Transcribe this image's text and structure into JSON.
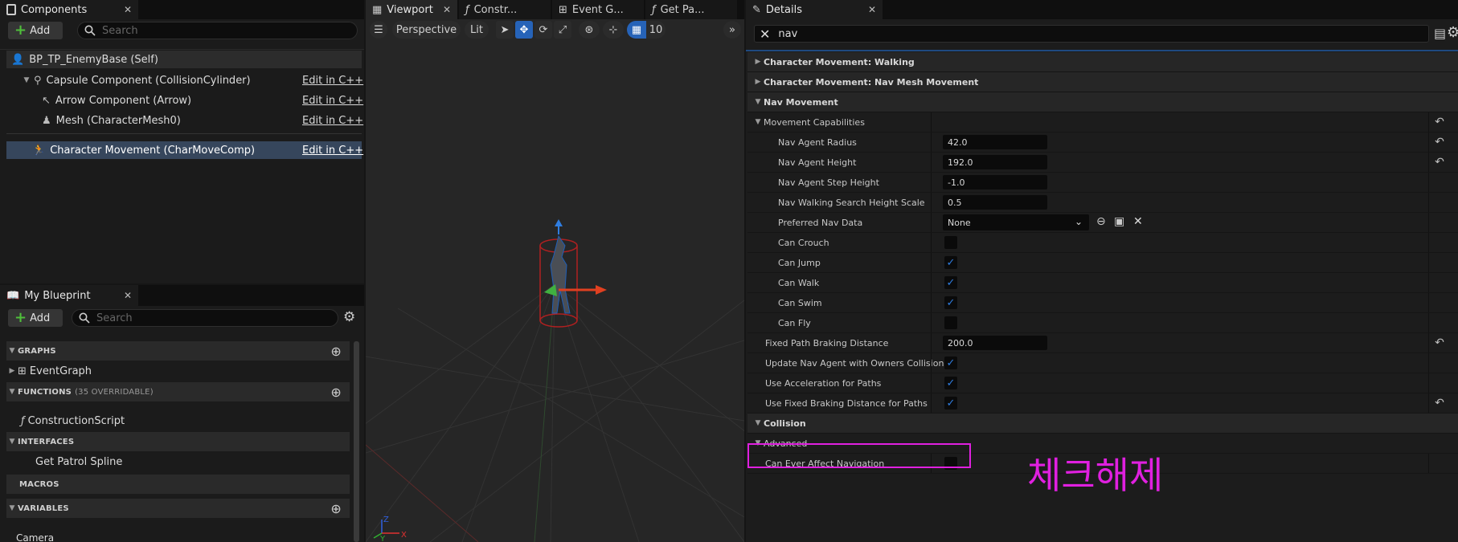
{
  "components": {
    "tab_title": "Components",
    "add_label": "Add",
    "search_placeholder": "Search",
    "root": "BP_TP_EnemyBase (Self)",
    "capsule": "Capsule Component (CollisionCylinder)",
    "arrow": "Arrow Component (Arrow)",
    "mesh": "Mesh (CharacterMesh0)",
    "charmove": "Character Movement (CharMoveComp)",
    "edit_label": "Edit in C++"
  },
  "my_blueprint": {
    "tab_title": "My Blueprint",
    "add_label": "Add",
    "search_placeholder": "Search",
    "graphs": "GRAPHS",
    "event_graph": "EventGraph",
    "functions": "FUNCTIONS",
    "functions_note": "(35 OVERRIDABLE)",
    "construction_script": "ConstructionScript",
    "interfaces": "INTERFACES",
    "get_patrol_spline": "Get Patrol Spline",
    "macros": "MACROS",
    "variables": "VARIABLES",
    "camera": "Camera"
  },
  "viewport": {
    "tabs": [
      "Viewport",
      "Constr...",
      "Event G...",
      "Get Pa..."
    ],
    "perspective": "Perspective",
    "lit": "Lit",
    "grid_size": "10",
    "axis_z": "Z",
    "axis_x": "X",
    "axis_y": "Y"
  },
  "details": {
    "tab_title": "Details",
    "search_value": "nav",
    "rows": {
      "cat_walking": "Character Movement: Walking",
      "cat_navmesh": "Character Movement: Nav Mesh Movement",
      "cat_navmove": "Nav Movement",
      "movement_caps": "Movement Capabilities",
      "agent_radius": "Nav Agent Radius",
      "agent_radius_val": "42.0",
      "agent_height": "Nav Agent Height",
      "agent_height_val": "192.0",
      "step_height": "Nav Agent Step Height",
      "step_height_val": "-1.0",
      "walk_search": "Nav Walking Search Height Scale",
      "walk_search_val": "0.5",
      "preferred_nav": "Preferred Nav Data",
      "preferred_nav_val": "None",
      "can_crouch": "Can Crouch",
      "can_jump": "Can Jump",
      "can_walk": "Can Walk",
      "can_swim": "Can Swim",
      "can_fly": "Can Fly",
      "fixed_braking": "Fixed Path Braking Distance",
      "fixed_braking_val": "200.0",
      "update_agent": "Update Nav Agent with Owners Collision",
      "use_accel": "Use Acceleration for Paths",
      "use_fixed_braking": "Use Fixed Braking Distance for Paths",
      "cat_collision": "Collision",
      "advanced": "Advanced",
      "can_affect_nav": "Can Ever Affect Navigation"
    }
  },
  "annotation": {
    "text": "체크해제",
    "color": "#e020e0"
  },
  "colors": {
    "accent_blue": "#2f7de0",
    "selected_row": "#36465c",
    "add_plus": "#4fbf3a"
  },
  "icons": [
    "components-icon",
    "search-icon",
    "person-icon",
    "capsule-icon",
    "arrow-icon",
    "mesh-icon",
    "movement-icon",
    "blueprint-icon",
    "gear-icon",
    "graph-icon",
    "function-icon",
    "add-circle-icon",
    "menu-icon",
    "select-icon",
    "move-icon",
    "rotate-icon",
    "scale-icon",
    "world-icon",
    "snap-icon",
    "grid-icon",
    "chevron-right-icon",
    "pencil-icon",
    "close-icon",
    "table-icon",
    "reset-icon",
    "browse-icon",
    "folder-icon",
    "clear-icon",
    "checkmark-icon"
  ]
}
